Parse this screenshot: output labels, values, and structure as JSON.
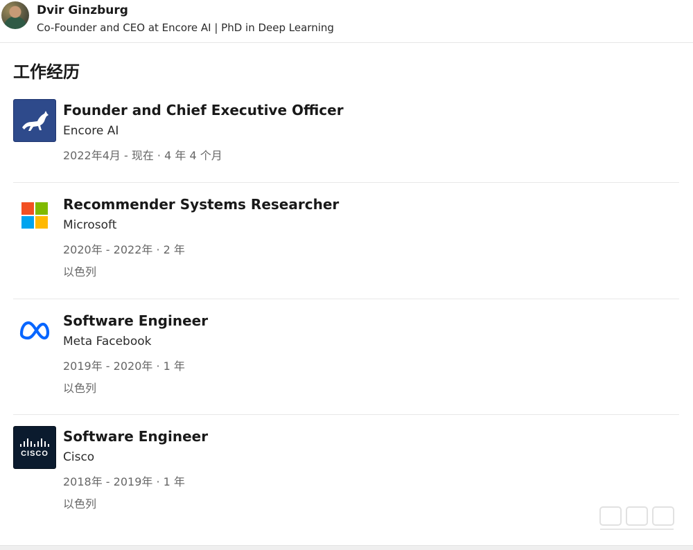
{
  "profile": {
    "name": "Dvir Ginzburg",
    "headline": "Co-Founder and CEO at Encore AI | PhD in Deep Learning"
  },
  "section": {
    "title": "工作经历"
  },
  "experience": [
    {
      "role": "Founder and Chief Executive Officer",
      "company": "Encore AI",
      "duration": "2022年4月 - 现在 · 4 年 4 个月",
      "logo_icon": "encore-horse-logo-icon",
      "logo_color": "#2e4a8b"
    },
    {
      "role": "Recommender Systems Researcher",
      "company": "Microsoft",
      "duration": "2020年 - 2022年 · 2 年",
      "location": "以色列",
      "logo_icon": "microsoft-logo-icon"
    },
    {
      "role": "Software Engineer",
      "company": "Meta Facebook",
      "duration": "2019年 - 2020年 · 1 年",
      "location": "以色列",
      "logo_icon": "meta-logo-icon",
      "logo_color": "#0866ff"
    },
    {
      "role": "Software Engineer",
      "company": "Cisco",
      "duration": "2018年 - 2019年 · 1 年",
      "location": "以色列",
      "logo_icon": "cisco-logo-icon",
      "logo_color": "#0b1b2e",
      "logo_text": "CISCO"
    }
  ],
  "watermark": {
    "icon": "zhidx-watermark-icon"
  }
}
